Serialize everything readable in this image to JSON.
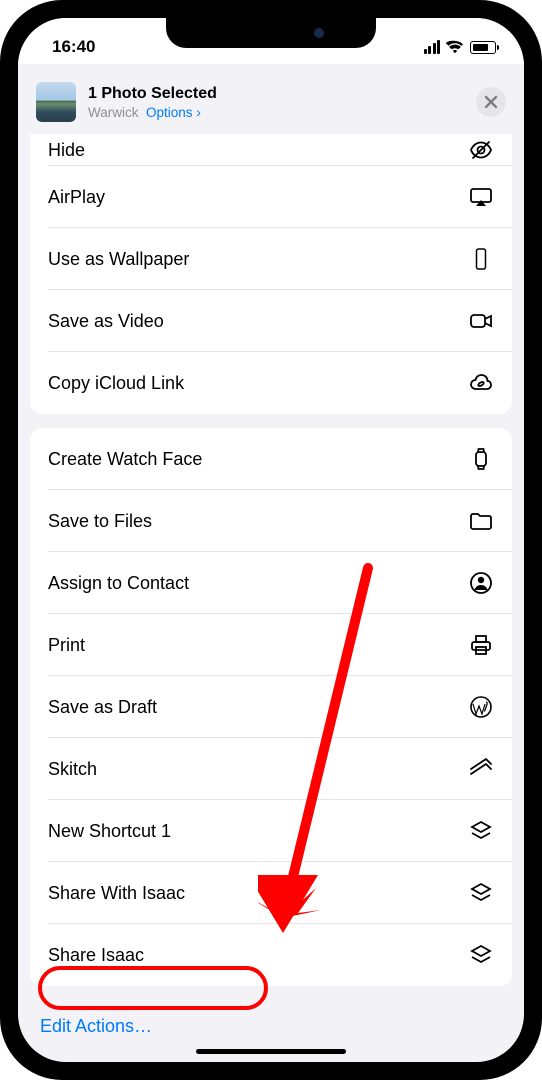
{
  "status": {
    "time": "16:40"
  },
  "header": {
    "title": "1 Photo Selected",
    "location": "Warwick",
    "options_label": "Options",
    "chevron": "›"
  },
  "groups": [
    {
      "items": [
        {
          "name": "hide",
          "label": "Hide",
          "icon": "eye-slash",
          "clipped": true
        },
        {
          "name": "airplay",
          "label": "AirPlay",
          "icon": "airplay"
        },
        {
          "name": "wallpaper",
          "label": "Use as Wallpaper",
          "icon": "phone-outline"
        },
        {
          "name": "save-video",
          "label": "Save as Video",
          "icon": "video"
        },
        {
          "name": "icloud-link",
          "label": "Copy iCloud Link",
          "icon": "cloud-link"
        }
      ]
    },
    {
      "items": [
        {
          "name": "watch-face",
          "label": "Create Watch Face",
          "icon": "watch"
        },
        {
          "name": "save-files",
          "label": "Save to Files",
          "icon": "folder"
        },
        {
          "name": "assign-contact",
          "label": "Assign to Contact",
          "icon": "person-circle"
        },
        {
          "name": "print",
          "label": "Print",
          "icon": "printer"
        },
        {
          "name": "save-draft",
          "label": "Save as Draft",
          "icon": "wordpress"
        },
        {
          "name": "skitch",
          "label": "Skitch",
          "icon": "skitch"
        },
        {
          "name": "new-shortcut",
          "label": "New Shortcut 1",
          "icon": "layers"
        },
        {
          "name": "share-with-isaac",
          "label": "Share With Isaac",
          "icon": "layers"
        },
        {
          "name": "share-isaac",
          "label": "Share Isaac",
          "icon": "layers"
        }
      ]
    }
  ],
  "edit_actions_label": "Edit Actions…"
}
